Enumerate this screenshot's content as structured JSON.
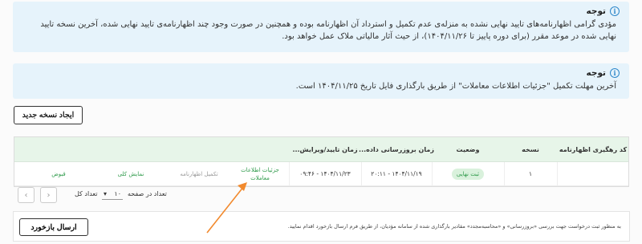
{
  "alerts": [
    {
      "title": "توجه",
      "body": "مؤدی گرامی اظهارنامه‌های تایید نهایی نشده به منزله‌ی عدم تکمیل و استرداد آن اظهارنامه بوده و همچنین در صورت وجود چند اظهارنامه‌ی تایید نهایی شده، آخرین نسخه تایید نهایی شده در موعد مقرر (برای دوره پاییز تا ۱۴۰۴/۱۱/۲۶)، از حیث آثار مالیاتی ملاک عمل خواهد بود."
    },
    {
      "title": "توجه",
      "body": "آخرین مهلت تکمیل \"جزئیات اطلاعات معاملات\" از طریق بارگذاری فایل تاریخ ۱۴۰۴/۱۱/۲۵ است."
    }
  ],
  "toolbar": {
    "new_version_label": "ایجاد نسخه جدید"
  },
  "table": {
    "headers": {
      "tracking_code": "کد رهگیری اظهارنامه",
      "version": "نسخه",
      "status": "وضعیت",
      "update_time": "زمان بروزرسانی داده...",
      "confirm_time": "زمان تایید/ویرایش..."
    },
    "row": {
      "tracking_code": "",
      "version": "۱",
      "status": "ثبت نهایی",
      "update_time": "۱۴۰۴/۱۱/۱۹ - ۲۰:۱۱",
      "confirm_time": "۱۴۰۴/۱۱/۲۳ - ۰۹:۴۶",
      "details_link": "جزئیات اطلاعات معاملات",
      "complete_link": "تکمیل اظهارنامه",
      "summary_link": "نمایش کلی",
      "receipt_link": "قبوض"
    }
  },
  "pager": {
    "total_label": "تعداد کل",
    "page_size_label": "تعداد در صفحه",
    "page_size_value": "۱۰",
    "chevron_down": "▾",
    "prev_glyph": "‹",
    "next_glyph": "›"
  },
  "footer": {
    "text": "به منظور ثبت درخواست جهت بررسی «بروزرسانی» و «محاسبه‌مجدد» مقادیر بارگذاری شده از سامانه مؤدیان، از طریق فرم ارسال بازخورد اقدام نمایید.",
    "send_feedback_label": "ارسال بازخورد"
  },
  "colors": {
    "alert_bg": "#e6f3fb",
    "info_icon": "#2b86c9",
    "table_header_bg": "#e7f5e9",
    "green_accent": "#2e9a4a",
    "annotation_arrow": "#f28a2e"
  }
}
